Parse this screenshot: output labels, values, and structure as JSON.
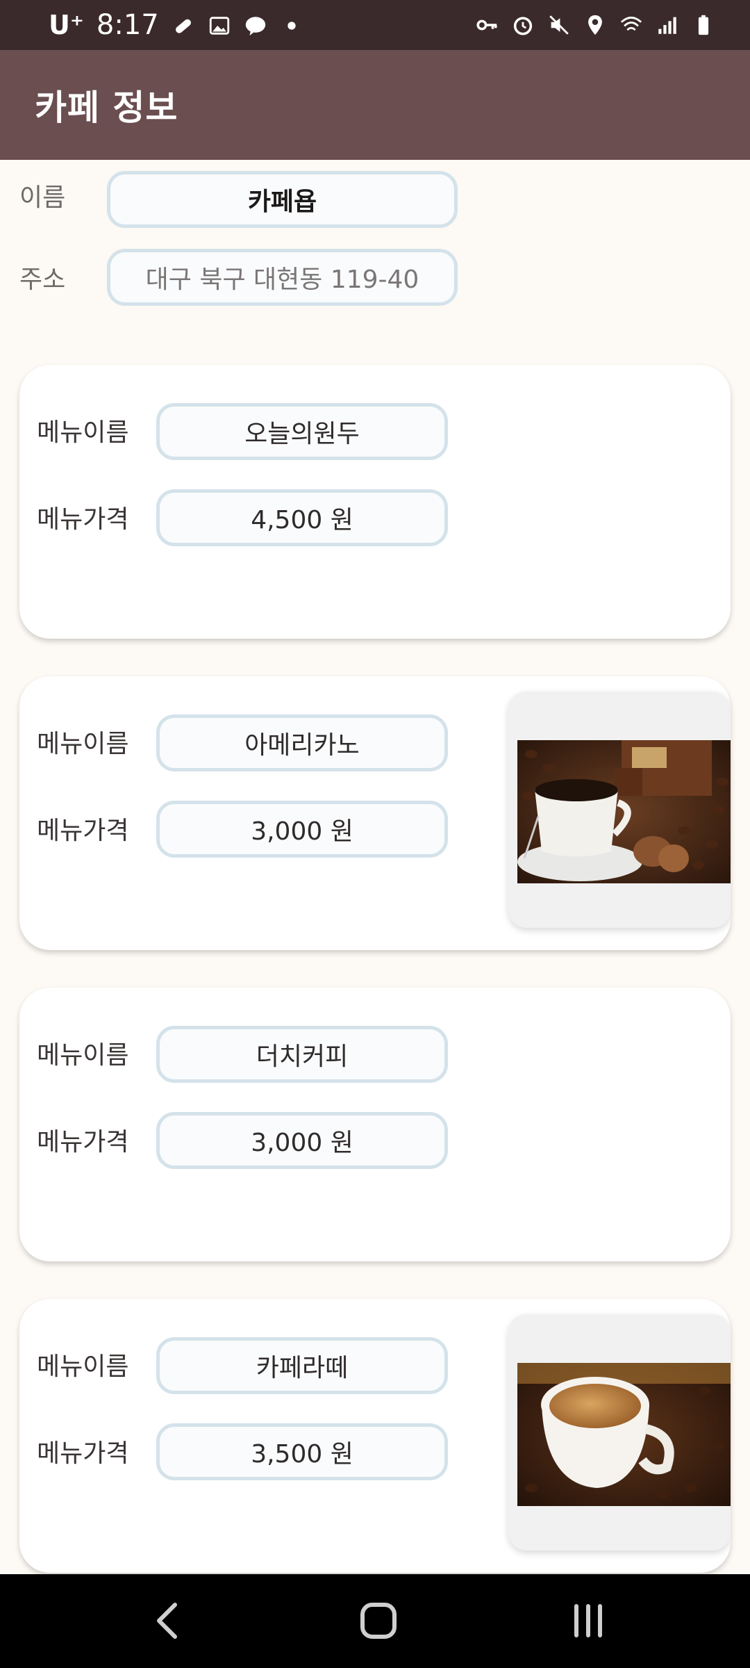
{
  "status": {
    "carrier": "U⁺",
    "time": "8:17"
  },
  "app_bar": {
    "title": "카페 정보"
  },
  "cafe": {
    "name_label": "이름",
    "name_value": "카페욥",
    "address_label": "주소",
    "address_value": "대구 북구 대현동 119-40"
  },
  "menu_labels": {
    "name": "메뉴이름",
    "price": "메뉴가격"
  },
  "menus": [
    {
      "name": "오늘의원두",
      "price": "4,500 원",
      "image": null
    },
    {
      "name": "아메리카노",
      "price": "3,000 원",
      "image": "coffee-cup-beans-photo"
    },
    {
      "name": "더치커피",
      "price": "3,000 원",
      "image": null
    },
    {
      "name": "카페라떼",
      "price": "3,500 원",
      "image": "espresso-cup-beans-photo"
    }
  ],
  "colors": {
    "status_bar": "#3b2a2b",
    "app_bar": "#6b4e50",
    "background": "#fdf9f4",
    "pill_border": "#d4e2ea"
  }
}
